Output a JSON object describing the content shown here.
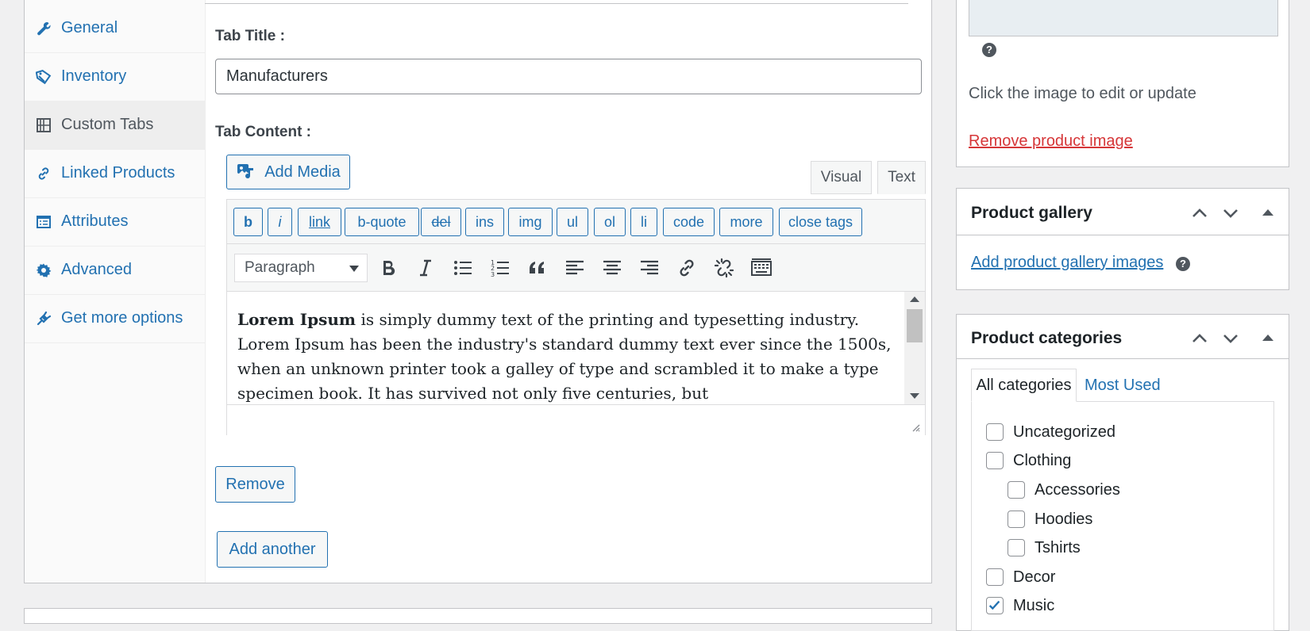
{
  "product_tabs": [
    {
      "label": "General",
      "icon": "wrench-icon"
    },
    {
      "label": "Inventory",
      "icon": "tag-icon"
    },
    {
      "label": "Custom Tabs",
      "icon": "table-icon"
    },
    {
      "label": "Linked Products",
      "icon": "link-icon"
    },
    {
      "label": "Attributes",
      "icon": "list-icon"
    },
    {
      "label": "Advanced",
      "icon": "gear-icon"
    },
    {
      "label": "Get more options",
      "icon": "plugin-icon"
    }
  ],
  "custom_tab": {
    "title_label": "Tab Title :",
    "title_value": "Manufacturers",
    "content_label": "Tab Content :",
    "add_media": "Add Media",
    "editor_tabs": {
      "visual": "Visual",
      "text": "Text"
    },
    "quicktags": [
      "b",
      "i",
      "link",
      "b-quote",
      "del",
      "ins",
      "img",
      "ul",
      "ol",
      "li",
      "code",
      "more",
      "close tags"
    ],
    "format_select": "Paragraph",
    "content_bold": "Lorem Ipsum",
    "content_rest": " is simply dummy text of the printing and typesetting industry. Lorem Ipsum has been the industry's standard dummy text ever since the 1500s, when an unknown printer took a galley of type and scrambled it to make a type specimen book. It has survived not only five centuries, but",
    "remove_button": "Remove",
    "add_another_button": "Add another"
  },
  "product_image": {
    "help": "?",
    "hint": "Click the image to edit or update",
    "remove_link": "Remove product image"
  },
  "product_gallery": {
    "title": "Product gallery",
    "add_link": "Add product gallery images",
    "help": "?"
  },
  "product_categories": {
    "title": "Product categories",
    "tabs": {
      "all": "All categories",
      "most_used": "Most Used"
    },
    "items": [
      {
        "label": "Uncategorized",
        "checked": false,
        "level": 0
      },
      {
        "label": "Clothing",
        "checked": false,
        "level": 0
      },
      {
        "label": "Accessories",
        "checked": false,
        "level": 1
      },
      {
        "label": "Hoodies",
        "checked": false,
        "level": 1
      },
      {
        "label": "Tshirts",
        "checked": false,
        "level": 1
      },
      {
        "label": "Decor",
        "checked": false,
        "level": 0
      },
      {
        "label": "Music",
        "checked": true,
        "level": 0
      }
    ]
  },
  "colors": {
    "link": "#2271b1",
    "danger": "#d63638",
    "border": "#c3c4c7"
  }
}
